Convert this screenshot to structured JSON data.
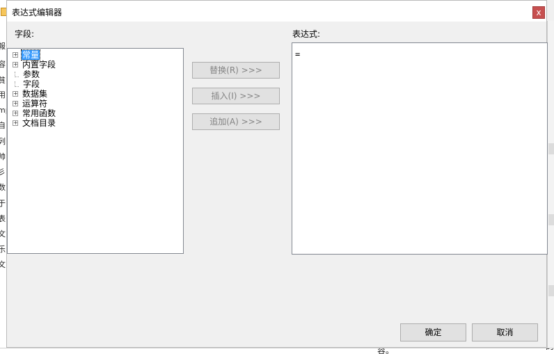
{
  "background": {
    "left_fragments": [
      "報",
      "容",
      "貧",
      "用",
      "mp",
      "自",
      "列",
      "帅",
      "彡",
      "数",
      "于",
      "表",
      "文",
      "乐",
      "文"
    ],
    "bottom_text": "容。",
    "bottom_text_right": "的"
  },
  "dialog": {
    "title": "表达式编辑器",
    "close_label": "x",
    "fields_label": "字段:",
    "expression_label": "表达式:",
    "tree": [
      {
        "label": "常量",
        "expandable": true,
        "selected": true
      },
      {
        "label": "内置字段",
        "expandable": true,
        "selected": false
      },
      {
        "label": "参数",
        "expandable": false,
        "selected": false
      },
      {
        "label": "字段",
        "expandable": false,
        "selected": false
      },
      {
        "label": "数据集",
        "expandable": true,
        "selected": false
      },
      {
        "label": "运算符",
        "expandable": true,
        "selected": false
      },
      {
        "label": "常用函数",
        "expandable": true,
        "selected": false
      },
      {
        "label": "文档目录",
        "expandable": true,
        "selected": false
      }
    ],
    "replace_label": "替换(R) >>>",
    "insert_label": "插入(I) >>>",
    "append_label": "追加(A) >>>",
    "expression_value": "=",
    "ok_label": "确定",
    "cancel_label": "取消"
  },
  "colors": {
    "selection": "#3399ff",
    "close_button": "#c75050",
    "dialog_background": "#f0f0f0"
  }
}
